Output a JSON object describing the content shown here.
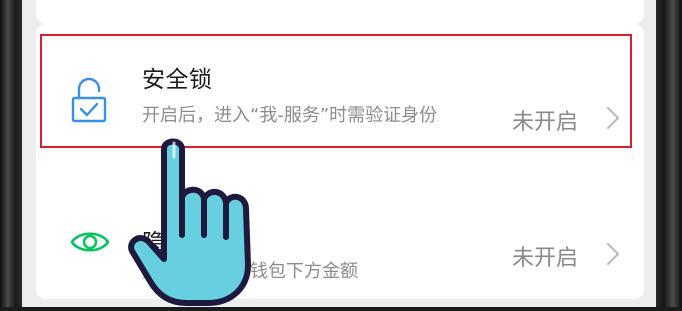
{
  "settings": {
    "items": [
      {
        "title": "安全锁",
        "subtitle": "开启后，进入“我-服务”时需验证身份",
        "status": "未开启",
        "icon": "lock-check-icon"
      },
      {
        "title": "隐私保护",
        "subtitle": "开启后，隐藏钱包下方金额",
        "status": "未开启",
        "icon": "eye-icon"
      }
    ]
  },
  "colors": {
    "highlight": "#d9212c",
    "lock_icon": "#3a8ee6",
    "eye_icon": "#07c160",
    "hand_fill": "#67cfe0",
    "hand_outline": "#1d1a3d"
  }
}
